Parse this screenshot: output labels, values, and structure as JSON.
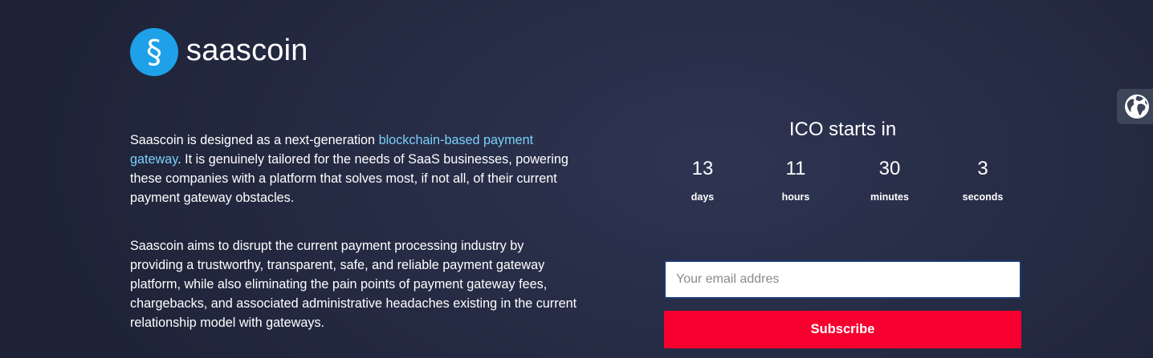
{
  "brand": {
    "name": "saascoin",
    "logo_glyph": "§",
    "logo_color": "#1ea1e8"
  },
  "intro": {
    "p1_before_link": "Saascoin is designed as a next-generation ",
    "p1_link": "blockchain-based payment gateway",
    "p1_after_link": ". It is genuinely tailored for the needs of SaaS businesses, powering these companies with a platform that solves most, if not all, of their current payment gateway obstacles.",
    "p2": "Saascoin aims to disrupt the current payment processing industry by providing a trustworthy, transparent, safe, and reliable payment gateway platform, while also eliminating the pain points of payment gateway fees, chargebacks, and associated administrative headaches existing in the current relationship model with gateways."
  },
  "countdown": {
    "title": "ICO starts in",
    "items": [
      {
        "value": "13",
        "unit": "days"
      },
      {
        "value": "11",
        "unit": "hours"
      },
      {
        "value": "30",
        "unit": "minutes"
      },
      {
        "value": "3",
        "unit": "seconds"
      }
    ]
  },
  "subscribe_form": {
    "email_placeholder": "Your email addres",
    "email_value": "",
    "button_label": "Subscribe",
    "button_color": "#f7002f"
  },
  "language_switcher": {
    "icon": "globe-icon"
  },
  "colors": {
    "background": "#262c45",
    "link": "#7ad0fb"
  }
}
